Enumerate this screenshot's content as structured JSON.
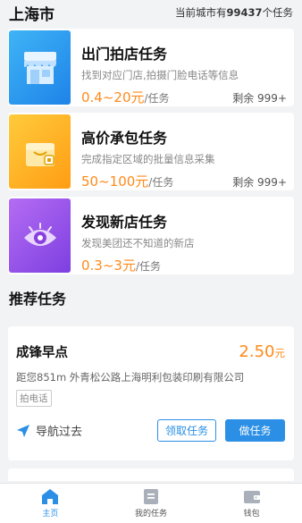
{
  "header": {
    "city": "上海市",
    "count_prefix": "当前城市有",
    "count_value": "99437",
    "count_suffix": "个任务"
  },
  "tasks": [
    {
      "title": "出门拍店任务",
      "desc": "找到对应门店,拍摄门脸电话等信息",
      "price": "0.4~20元",
      "unit": "/任务",
      "remain": "剩余 999+",
      "icon": "storefront-icon",
      "color": "#2a99ef"
    },
    {
      "title": "高价承包任务",
      "desc": "完成指定区域的批量信息采集",
      "price": "50~100元",
      "unit": "/任务",
      "remain": "剩余 999+",
      "icon": "package-icon",
      "color": "#ffb426"
    },
    {
      "title": "发现新店任务",
      "desc": "发现美团还不知道的新店",
      "price": "0.3~3元",
      "unit": "/任务",
      "remain": "",
      "icon": "eye-icon",
      "color": "#9a55ea"
    }
  ],
  "recommend": {
    "section_title": "推荐任务",
    "name": "成锋早点",
    "price": "2.50",
    "price_unit": "元",
    "address": "距您851m  外青松公路上海明利包装印刷有限公司",
    "tag": "拍电话",
    "nav_label": "导航过去",
    "claim_label": "领取任务",
    "do_label": "做任务"
  },
  "tabbar": [
    {
      "label": "主页",
      "icon": "home-icon",
      "active": true
    },
    {
      "label": "我的任务",
      "icon": "task-list-icon",
      "active": false
    },
    {
      "label": "钱包",
      "icon": "wallet-icon",
      "active": false
    }
  ],
  "colors": {
    "accent": "#2b8fe6",
    "price": "#ff8a1a"
  }
}
